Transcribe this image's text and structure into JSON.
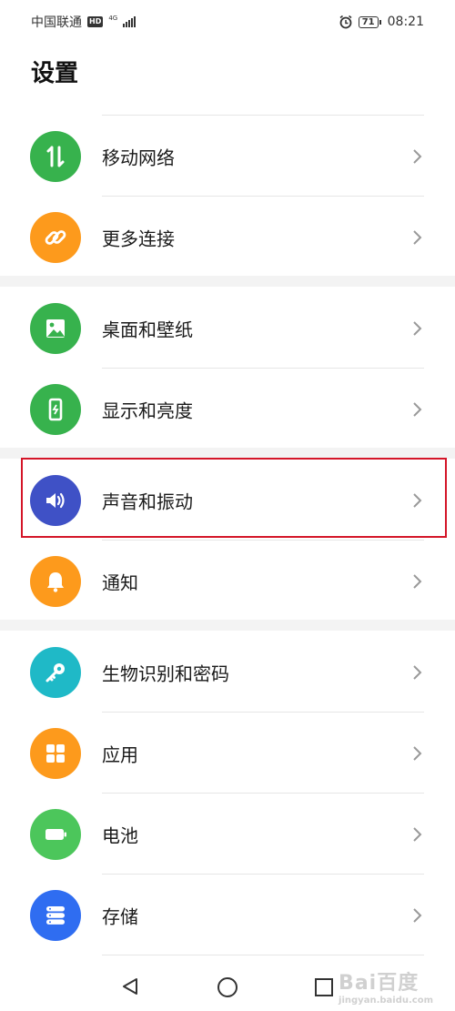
{
  "status_bar": {
    "carrier": "中国联通",
    "hd": "HD",
    "network": "4G",
    "battery": "71",
    "time": "08:21"
  },
  "page": {
    "title": "设置"
  },
  "colors": {
    "green": "#37b24d",
    "orange": "#fd9a1c",
    "blue_indigo": "#3f51c6",
    "teal": "#1fb9c7",
    "light_green": "#4cc65b",
    "blue": "#2f6df1",
    "highlight": "#d41528"
  },
  "settings": [
    {
      "label": "移动网络",
      "icon": "mobile-data-icon"
    },
    {
      "label": "更多连接",
      "icon": "link-icon"
    },
    {
      "label": "桌面和壁纸",
      "icon": "image-icon"
    },
    {
      "label": "显示和亮度",
      "icon": "phone-brightness-icon"
    },
    {
      "label": "声音和振动",
      "icon": "speaker-icon"
    },
    {
      "label": "通知",
      "icon": "bell-icon"
    },
    {
      "label": "生物识别和密码",
      "icon": "key-icon"
    },
    {
      "label": "应用",
      "icon": "apps-grid-icon"
    },
    {
      "label": "电池",
      "icon": "battery-icon"
    },
    {
      "label": "存储",
      "icon": "storage-icon"
    }
  ],
  "watermark": {
    "main": "Bai百度",
    "sub": "jingyan.baidu.com"
  }
}
